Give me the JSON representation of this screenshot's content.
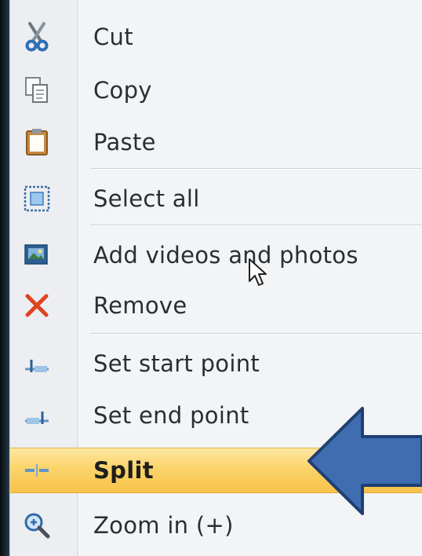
{
  "menu": {
    "items": [
      {
        "label": "Cut",
        "icon": "scissors-icon"
      },
      {
        "label": "Copy",
        "icon": "copy-icon"
      },
      {
        "label": "Paste",
        "icon": "clipboard-icon"
      },
      {
        "label": "Select all",
        "icon": "select-all-icon"
      },
      {
        "label": "Add videos and photos",
        "icon": "add-media-icon"
      },
      {
        "label": "Remove",
        "icon": "remove-icon"
      },
      {
        "label": "Set start point",
        "icon": "start-point-icon"
      },
      {
        "label": "Set end point",
        "icon": "end-point-icon"
      },
      {
        "label": "Split",
        "icon": "split-icon",
        "highlighted": true
      },
      {
        "label": "Zoom in (+)",
        "icon": "zoom-in-icon"
      }
    ]
  },
  "colors": {
    "highlight": "#fbd46a",
    "arrow_fill": "#3f6db0",
    "remove_icon": "#e0431f"
  }
}
